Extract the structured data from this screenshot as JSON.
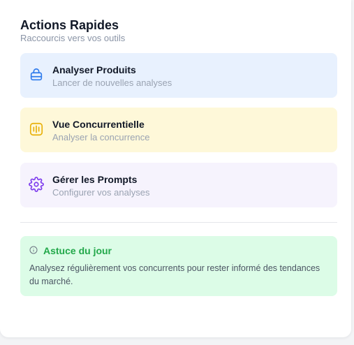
{
  "panel": {
    "title": "Actions Rapides",
    "subtitle": "Raccourcis vers vos outils"
  },
  "actions": [
    {
      "label": "Analyser Produits",
      "description": "Lancer de nouvelles analyses",
      "icon": "shopping-bag-icon",
      "bg_color": "#e8f1fe",
      "icon_color": "#2f7bec"
    },
    {
      "label": "Vue Concurrentielle",
      "description": "Analyser la concurrence",
      "icon": "audio-compare-icon",
      "bg_color": "#fef8d9",
      "icon_color": "#e8b008"
    },
    {
      "label": "Gérer les Prompts",
      "description": "Configurer vos analyses",
      "icon": "gear-icon",
      "bg_color": "#f6f3fd",
      "icon_color": "#7c3aed"
    }
  ],
  "tip": {
    "title": "Astuce du jour",
    "text": "Analysez régulièrement vos concurrents pour rester informé des tendances du marché.",
    "icon": "info-icon",
    "bg_color": "#dcfce7",
    "accent_color": "#22a84a"
  }
}
